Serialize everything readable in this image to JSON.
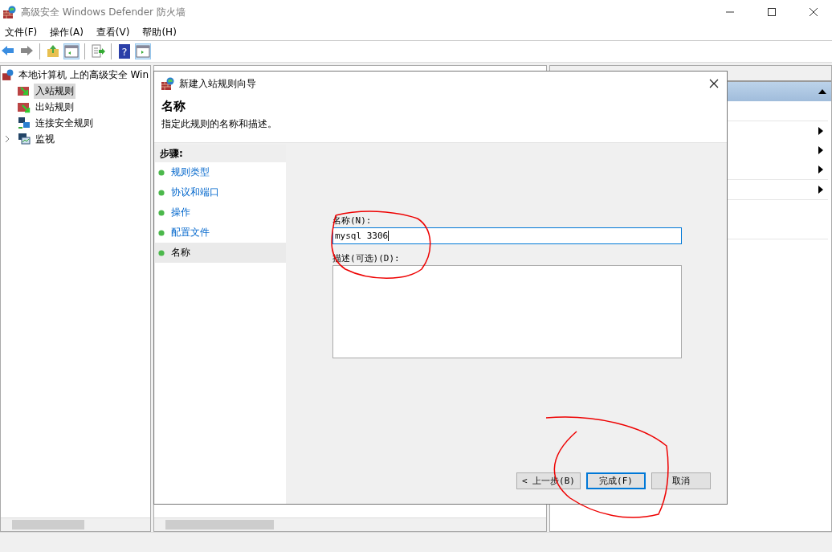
{
  "window": {
    "title": "高级安全 Windows Defender 防火墙"
  },
  "menu": [
    "文件(F)",
    "操作(A)",
    "查看(V)",
    "帮助(H)"
  ],
  "toolbar": {
    "help_glyph": "?"
  },
  "tree": {
    "label": "本地计算机 上的高级安全 Win",
    "children": [
      {
        "label": "入站规则",
        "selected": true
      },
      {
        "label": "出站规则",
        "selected": false
      },
      {
        "label": "连接安全规则",
        "selected": false
      },
      {
        "label": "监视",
        "selected": false,
        "expanded": false
      }
    ]
  },
  "dialog": {
    "title": "新建入站规则向导",
    "heading": "名称",
    "subtitle": "指定此规则的名称和描述。",
    "steps_title": "步骤:",
    "steps": [
      {
        "label": "规则类型",
        "selected": false
      },
      {
        "label": "协议和端口",
        "selected": false
      },
      {
        "label": "操作",
        "selected": false
      },
      {
        "label": "配置文件",
        "selected": false
      },
      {
        "label": "名称",
        "selected": true
      }
    ],
    "name_label": "名称(N):",
    "name_value": "mysql 3306",
    "description_label": "描述(可选)(D):",
    "buttons": [
      {
        "label": "< 上一步(B)",
        "default": false
      },
      {
        "label": "完成(F)",
        "default": true
      },
      {
        "label": "取消",
        "default": false
      }
    ]
  }
}
